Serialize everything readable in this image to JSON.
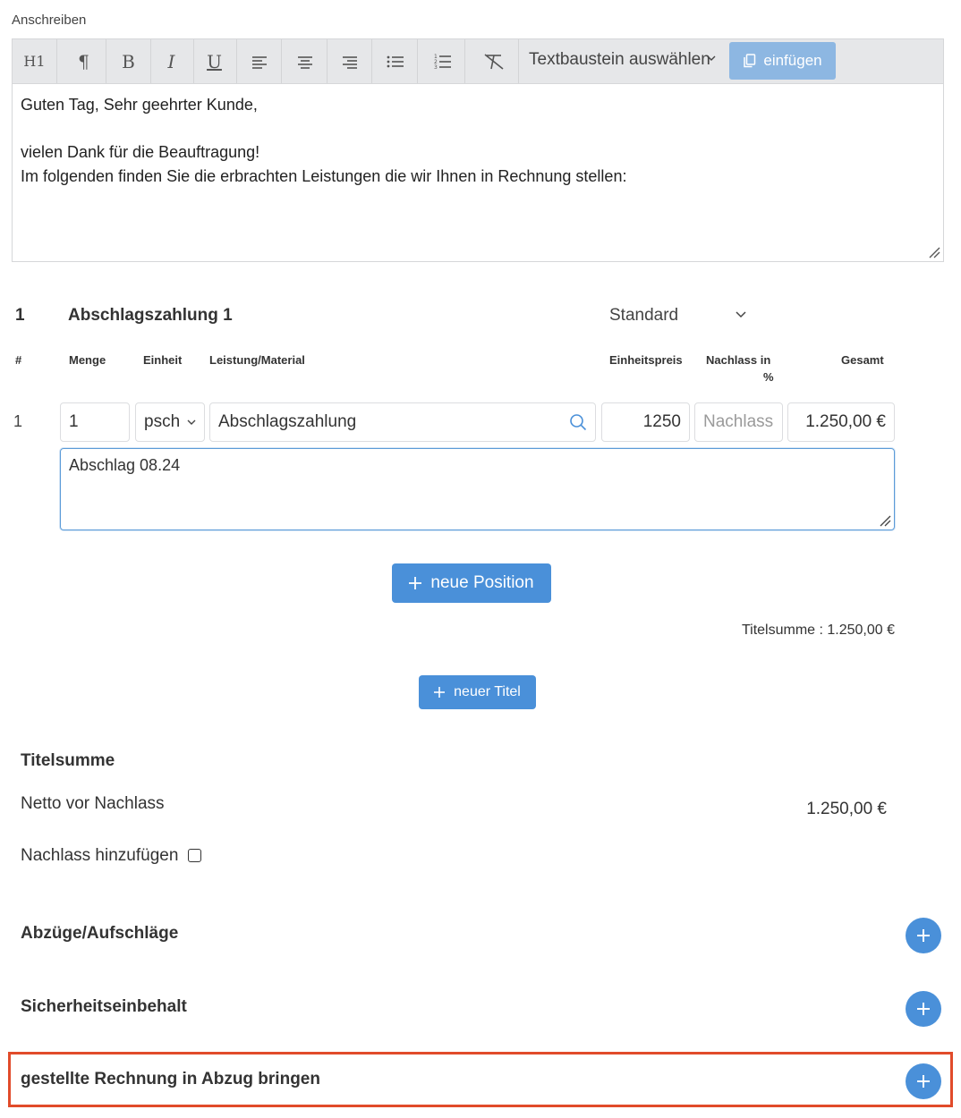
{
  "editor": {
    "section_label": "Anschreiben",
    "toolbar": {
      "heading_label": "H1",
      "textbaustein_select": "Textbaustein auswählen",
      "insert_button": "einfügen"
    },
    "content_lines": [
      "Guten Tag, Sehr geehrter Kunde,",
      "",
      "vielen Dank für die Beauftragung!",
      "Im folgenden finden Sie die erbrachten Leistungen die wir Ihnen in Rechnung stellen:"
    ]
  },
  "title_block": {
    "number": "1",
    "name": "Abschlagszahlung 1",
    "type": "Standard",
    "columns": {
      "number": "#",
      "quantity": "Menge",
      "unit": "Einheit",
      "service": "Leistung/Material",
      "unit_price": "Einheitspreis",
      "discount_line1": "Nachlass in",
      "discount_line2": "%",
      "total": "Gesamt"
    },
    "positions": [
      {
        "number": "1",
        "quantity": "1",
        "unit": "psch",
        "service": "Abschlagszahlung",
        "unit_price": "1250",
        "discount_placeholder": "Nachlass",
        "total": "1.250,00 €",
        "description": "Abschlag 08.24"
      }
    ],
    "new_position_button": "neue Position",
    "title_sum_text": "Titelsumme : 1.250,00 €"
  },
  "new_title_button": "neuer Titel",
  "summary": {
    "heading": "Titelsumme",
    "net_label": "Netto vor Nachlass",
    "net_value": "1.250,00 €",
    "discount_toggle_label": "Nachlass hinzufügen"
  },
  "sections": {
    "deductions": "Abzüge/Aufschläge",
    "retention": "Sicherheitseinbehalt",
    "deduct_invoice": "gestellte Rechnung in Abzug bringen"
  },
  "colors": {
    "primary": "#4a90d9",
    "primary_light": "#8db7e2",
    "highlight": "#e14b2a",
    "toolbar_bg": "#e6e7e9"
  }
}
